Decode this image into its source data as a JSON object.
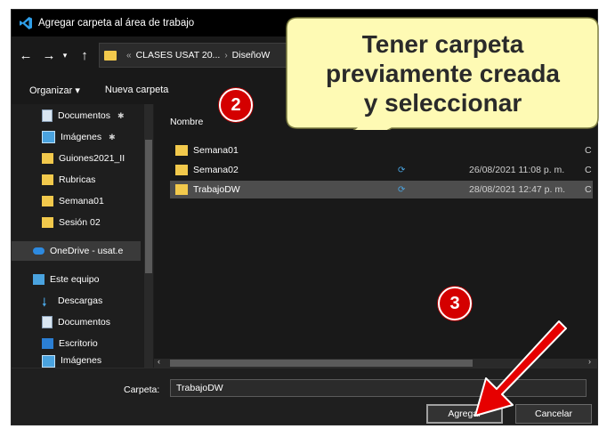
{
  "window": {
    "title": "Agregar carpeta al área de trabajo"
  },
  "nav": {
    "back": "←",
    "forward": "→",
    "recent": "▾",
    "up": "↑",
    "breadcrumb": [
      "CLASES USAT 20...",
      "DiseñoW"
    ],
    "overflow": "«"
  },
  "commands": {
    "organize": "Organizar ▾",
    "new_folder": "Nueva carpeta"
  },
  "sidebar": {
    "items": [
      {
        "label": "Documentos",
        "icon": "document-icon",
        "pinned": true
      },
      {
        "label": "Imágenes",
        "icon": "pictures-icon",
        "pinned": true
      },
      {
        "label": "Guiones2021_II",
        "icon": "folder-icon"
      },
      {
        "label": "Rubricas",
        "icon": "folder-icon"
      },
      {
        "label": "Semana01",
        "icon": "folder-icon"
      },
      {
        "label": "Sesión 02",
        "icon": "folder-icon"
      },
      {
        "label": "OneDrive - usat.e",
        "icon": "cloud-icon",
        "selected": true
      },
      {
        "label": "Este equipo",
        "icon": "pc-icon"
      },
      {
        "label": "Descargas",
        "icon": "download-icon"
      },
      {
        "label": "Documentos",
        "icon": "document-icon"
      },
      {
        "label": "Escritorio",
        "icon": "desktop-icon"
      },
      {
        "label": "Imágenes",
        "icon": "pictures-icon"
      }
    ]
  },
  "filelist": {
    "column_name": "Nombre",
    "rows": [
      {
        "name": "Semana01",
        "sync": "",
        "date": "",
        "cut": "C"
      },
      {
        "name": "Semana02",
        "sync": "⟳",
        "date": "26/08/2021 11:08 p. m.",
        "cut": "C"
      },
      {
        "name": "TrabajoDW",
        "sync": "⟳",
        "date": "28/08/2021 12:47 p. m.",
        "cut": "C",
        "selected": true
      }
    ]
  },
  "bottom": {
    "folder_label": "Carpeta:",
    "folder_value": "TrabajoDW",
    "add_button": "Agregar",
    "cancel_button": "Cancelar"
  },
  "annotations": {
    "callout_lines": [
      "Tener carpeta",
      "previamente creada",
      "y seleccionar"
    ],
    "step2": "2",
    "step3": "3"
  },
  "colors": {
    "accent_folder": "#f2c94c",
    "badge": "#d40000",
    "callout": "#fefab4"
  }
}
